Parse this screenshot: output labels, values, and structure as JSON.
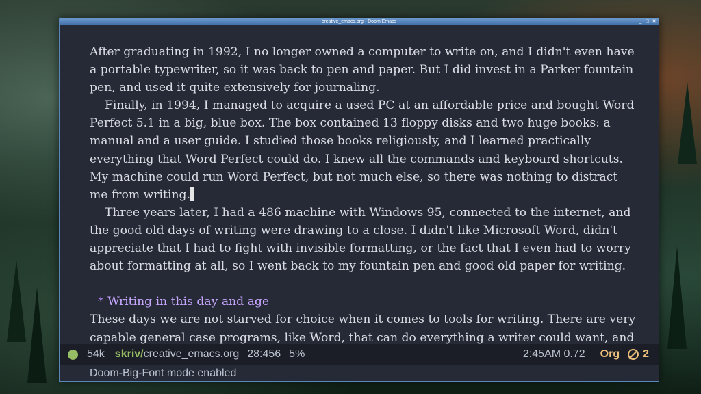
{
  "window": {
    "title": "creative_emacs.org - Doom Emacs",
    "controls": {
      "minimize": "_",
      "maximize": "□",
      "close": "✕"
    }
  },
  "editor": {
    "paragraph1": "After graduating in 1992, I no longer owned a computer to write on, and I didn't even have a portable typewriter, so it was back to pen and paper. But I did invest in a Parker fountain pen, and used it quite extensively for journaling.",
    "paragraph2": "Finally, in 1994, I managed to acquire a used PC at an affordable price and bought Word Perfect 5.1 in a big, blue box. The box contained 13 floppy disks and two huge books: a manual and a user guide. I studied those books religiously, and I learned practically everything that Word Perfect could do. I knew all the commands and keyboard shortcuts. My machine could run Word Perfect, but not much else, so there was nothing to distract me from writing.",
    "paragraph3": "Three years later, I had a 486 machine with Windows 95, connected to the internet, and the good old days of writing were drawing to a close. I didn't like Microsoft Word, didn't appreciate that I had to fight with invisible formatting, or the fact that I even had to worry about formatting at all, so I went back to my fountain pen and good old paper for writing.",
    "heading_star": "*",
    "heading": "Writing in this day and age",
    "paragraph4": "These days we are not starved for choice when it comes to tools for writing. There are very capable general case programs, like Word, that can do everything a writer could want, and"
  },
  "modeline": {
    "size": "54k",
    "dir": "skriv/",
    "file": "creative_emacs.org",
    "position": "28:456",
    "percent": "5%",
    "time_load": "2:45AM 0.72",
    "major_mode": "Org",
    "issue_count": "2",
    "colors": {
      "ok": "#98be65",
      "warning": "#ecbe7b"
    }
  },
  "echo_area": {
    "message": "Doom-Big-Font mode enabled"
  }
}
